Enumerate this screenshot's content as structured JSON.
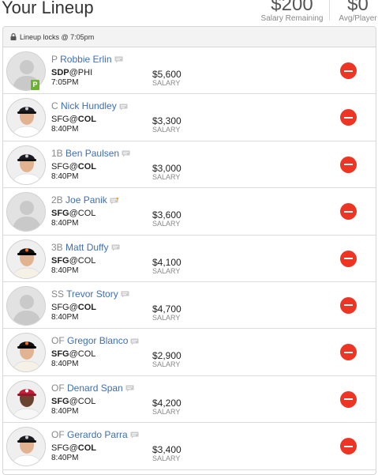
{
  "header": {
    "title": "Your Lineup",
    "salary_remaining": {
      "value": "$200",
      "label": "Salary Remaining"
    },
    "avg_player": {
      "value": "$0",
      "label": "Avg/Player"
    }
  },
  "lineup": {
    "lock_text": "Lineup locks @ 7:05pm",
    "players": [
      {
        "pos": "P",
        "name": "Robbie Erlin",
        "team": "SDP",
        "opp": "PHI",
        "bold": "team",
        "time": "7:05PM",
        "salary": "$5,600",
        "salary_label": "SALARY",
        "avatar": "placeholder",
        "probable": "P"
      },
      {
        "pos": "C",
        "name": "Nick Hundley",
        "team": "SFG",
        "opp": "COL",
        "bold": "opp",
        "time": "8:40PM",
        "salary": "$3,300",
        "salary_label": "SALARY",
        "avatar": "rockies"
      },
      {
        "pos": "1B",
        "name": "Ben Paulsen",
        "team": "SFG",
        "opp": "COL",
        "bold": "opp",
        "time": "8:40PM",
        "salary": "$3,000",
        "salary_label": "SALARY",
        "avatar": "rockies"
      },
      {
        "pos": "2B",
        "name": "Joe Panik",
        "team": "SFG",
        "opp": "COL",
        "bold": "team",
        "time": "8:40PM",
        "salary": "$3,600",
        "salary_label": "SALARY",
        "avatar": "placeholder",
        "news": true
      },
      {
        "pos": "3B",
        "name": "Matt Duffy",
        "team": "SFG",
        "opp": "COL",
        "bold": "team",
        "time": "8:40PM",
        "salary": "$4,100",
        "salary_label": "SALARY",
        "avatar": "giants"
      },
      {
        "pos": "SS",
        "name": "Trevor Story",
        "team": "SFG",
        "opp": "COL",
        "bold": "opp",
        "time": "8:40PM",
        "salary": "$4,700",
        "salary_label": "SALARY",
        "avatar": "placeholder"
      },
      {
        "pos": "OF",
        "name": "Gregor Blanco",
        "team": "SFG",
        "opp": "COL",
        "bold": "team",
        "time": "8:40PM",
        "salary": "$2,900",
        "salary_label": "SALARY",
        "avatar": "giants"
      },
      {
        "pos": "OF",
        "name": "Denard Span",
        "team": "SFG",
        "opp": "COL",
        "bold": "team",
        "time": "8:40PM",
        "salary": "$4,200",
        "salary_label": "SALARY",
        "avatar": "nationals"
      },
      {
        "pos": "OF",
        "name": "Gerardo Parra",
        "team": "SFG",
        "opp": "COL",
        "bold": "opp",
        "time": "8:40PM",
        "salary": "$3,400",
        "salary_label": "SALARY",
        "avatar": "rockies"
      }
    ]
  },
  "icons": {
    "lock": "lock-icon",
    "note": "note-icon",
    "remove": "remove-icon",
    "probable": "probable-pitcher-badge"
  },
  "colors": {
    "remove": "#ee3524",
    "player_name": "#3d6fb5",
    "probable_badge": "#6ab42d",
    "news_dot": "#f5a623"
  }
}
